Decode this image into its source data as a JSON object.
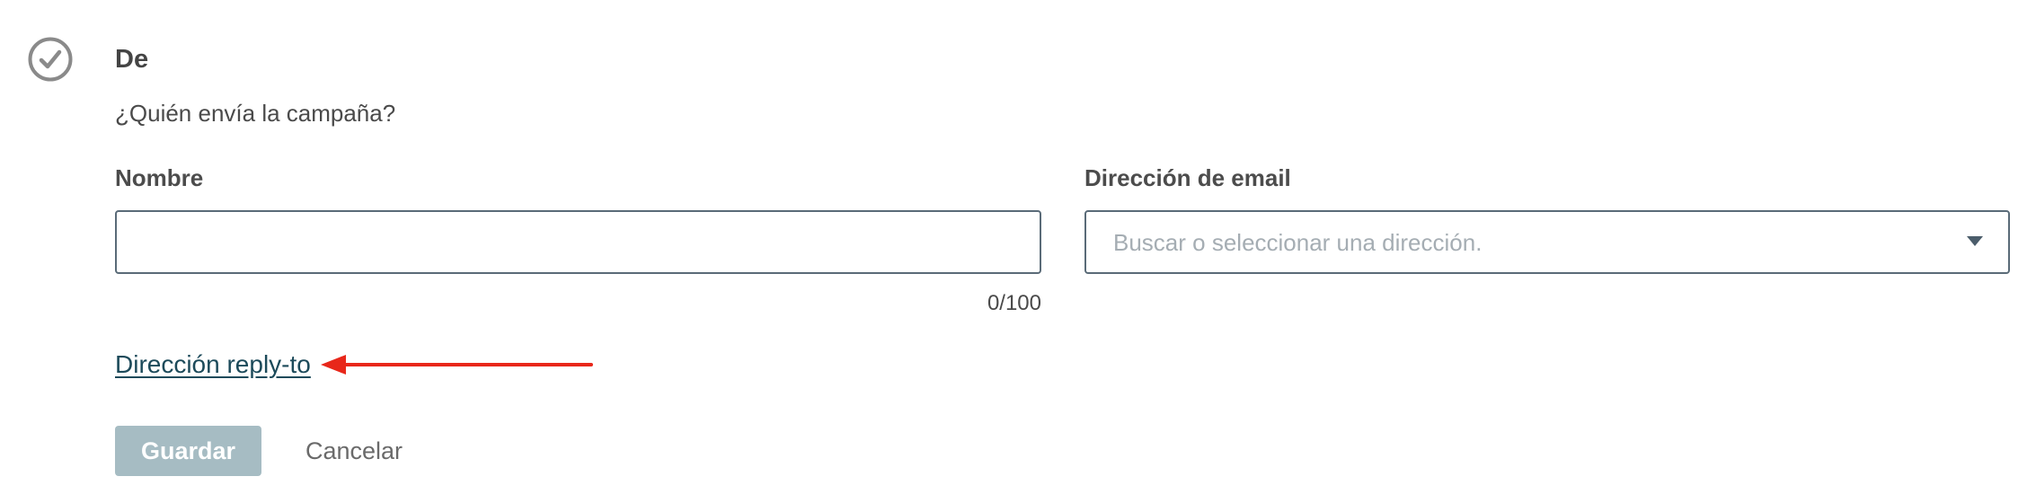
{
  "section": {
    "title": "De",
    "subtitle": "¿Quién envía la campaña?",
    "status_icon": "check-circle-icon"
  },
  "name_field": {
    "label": "Nombre",
    "value": "",
    "counter": "0/100"
  },
  "email_field": {
    "label": "Dirección de email",
    "placeholder": "Buscar o seleccionar una dirección.",
    "dropdown_icon": "chevron-down-icon"
  },
  "reply_to_link": "Dirección reply-to",
  "annotation": {
    "type": "arrow",
    "color": "#e8271a"
  },
  "actions": {
    "save_label": "Guardar",
    "cancel_label": "Cancelar"
  },
  "colors": {
    "input_border": "#5a6b78",
    "link": "#1c4a5a",
    "save_button_bg": "#a6bcc3",
    "placeholder": "#a5adb3"
  }
}
